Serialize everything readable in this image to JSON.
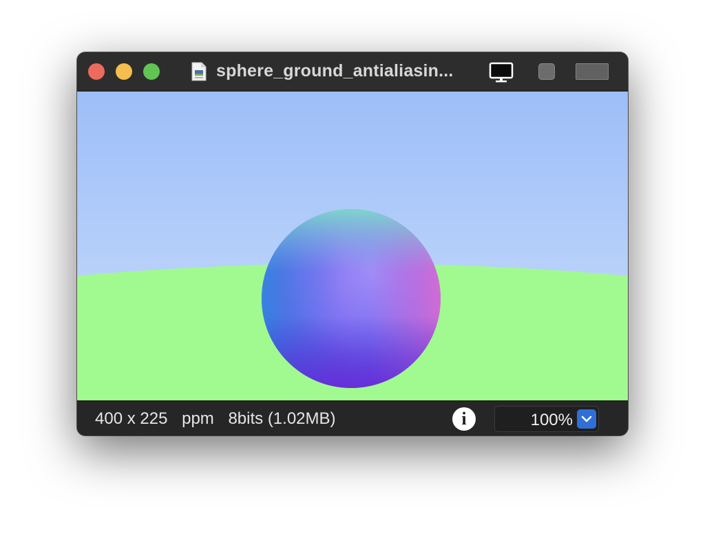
{
  "window": {
    "title": "sphere_ground_antialiasin...",
    "buttons": {
      "close": "close-button",
      "minimize": "minimize-button",
      "zoom": "zoom-button"
    },
    "icons": [
      "document-icon",
      "monitor-icon",
      "square-icon",
      "rectangle-icon"
    ]
  },
  "image": {
    "description_colors": {
      "sky_top": "#9dbef8",
      "sky_bottom": "#c8dcfb",
      "ground": "#a1fa8f"
    }
  },
  "status": {
    "dimensions": "400 x 225",
    "format": "ppm",
    "bits_size": "8bits (1.02MB)",
    "info_icon": "info-icon",
    "zoom": "100%"
  }
}
